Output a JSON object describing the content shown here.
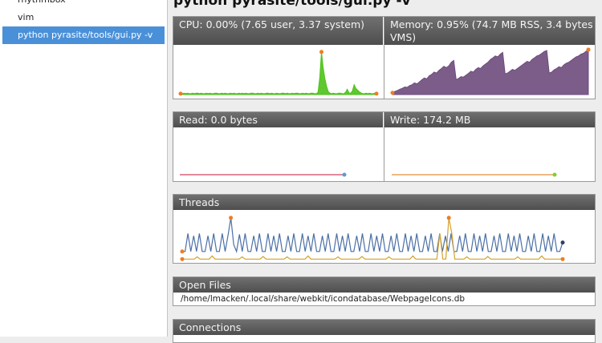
{
  "sidebar": {
    "items": [
      {
        "label": "rhythmbox"
      },
      {
        "label": "vim"
      },
      {
        "label": "python pyrasite/tools/gui.py -v"
      }
    ]
  },
  "title": "python pyrasite/tools/gui.py -v",
  "cpu": {
    "label": "CPU: 0.00% (7.65 user, 3.37 system)",
    "color": "#4ec21a",
    "values": [
      2,
      2,
      3,
      2,
      3,
      2,
      2,
      3,
      2,
      3,
      3,
      2,
      3,
      2,
      2,
      3,
      2,
      3,
      2,
      2,
      3,
      3,
      2,
      2,
      3,
      2,
      3,
      2,
      2,
      3,
      2,
      3,
      2,
      2,
      3,
      2,
      3,
      2,
      3,
      2,
      2,
      3,
      3,
      2,
      2,
      3,
      2,
      3,
      2,
      2,
      3,
      3,
      2,
      3,
      2,
      2,
      3,
      2,
      2,
      3,
      3,
      2,
      3,
      2,
      2,
      3,
      2,
      3,
      3,
      2,
      2,
      3,
      2,
      3,
      2,
      2,
      3,
      3,
      2,
      2,
      5,
      38,
      95,
      60,
      35,
      18,
      6,
      3,
      2,
      3,
      2,
      2,
      3,
      3,
      2,
      2,
      5,
      12,
      4,
      3,
      8,
      22,
      14,
      10,
      6,
      4,
      2,
      2,
      3,
      2,
      3,
      2,
      2,
      3,
      2
    ]
  },
  "memory": {
    "label": "Memory: 0.95% (74.7 MB RSS, 3.4 bytes VMS)",
    "color": "#6e4b7c",
    "values": [
      4,
      7,
      9,
      12,
      14,
      17,
      16,
      20,
      22,
      26,
      24,
      28,
      33,
      37,
      35,
      42,
      45,
      50,
      48,
      54,
      58,
      63,
      60,
      64,
      72,
      76,
      33,
      36,
      40,
      39,
      43,
      47,
      52,
      50,
      56,
      60,
      58,
      64,
      68,
      72,
      78,
      82,
      86,
      84,
      90,
      94,
      46,
      48,
      52,
      56,
      54,
      58,
      62,
      66,
      70,
      74,
      72,
      78,
      82,
      86,
      88,
      92,
      96,
      98,
      48,
      50,
      55,
      58,
      62,
      60,
      66,
      70,
      72,
      76,
      80,
      84,
      86,
      90,
      92,
      96,
      100
    ]
  },
  "read": {
    "label": "Read: 0.0 bytes",
    "color": "#d9627b",
    "end_color": "#5b9bd5"
  },
  "write": {
    "label": "Write: 174.2 MB",
    "color": "#e8a45a",
    "end_color": "#7cd12e"
  },
  "threads": {
    "label": "Threads",
    "series": [
      {
        "color": "#4a6fa5",
        "values": [
          20,
          20,
          60,
          20,
          55,
          20,
          60,
          20,
          20,
          55,
          20,
          60,
          20,
          20,
          60,
          20,
          55,
          95,
          35,
          20,
          58,
          20,
          60,
          20,
          20,
          55,
          20,
          60,
          20,
          20,
          60,
          20,
          55,
          20,
          60,
          20,
          20,
          55,
          20,
          60,
          20,
          20,
          60,
          20,
          55,
          20,
          60,
          20,
          20,
          55,
          20,
          60,
          20,
          20,
          60,
          20,
          55,
          20,
          60,
          20,
          20,
          55,
          20,
          60,
          20,
          20,
          60,
          20,
          55,
          20,
          60,
          20,
          20,
          55,
          20,
          60,
          20,
          20,
          60,
          20,
          55,
          20,
          60,
          20,
          20,
          55,
          20,
          60,
          20,
          20,
          60,
          20,
          55,
          20,
          60,
          20,
          20,
          55,
          20,
          60,
          20,
          20,
          60,
          20,
          55,
          20,
          60,
          20,
          20,
          55,
          20,
          60,
          20,
          20,
          60,
          20,
          55,
          20,
          60,
          20,
          20,
          55,
          20,
          60,
          20,
          20,
          60,
          20,
          55,
          20,
          60,
          20,
          20,
          40
        ]
      },
      {
        "color": "#d4a12a",
        "values": [
          3,
          3,
          3,
          3,
          3,
          8,
          3,
          3,
          3,
          3,
          10,
          3,
          3,
          3,
          3,
          3,
          3,
          3,
          3,
          3,
          8,
          3,
          3,
          3,
          3,
          3,
          3,
          9,
          3,
          3,
          3,
          3,
          3,
          3,
          3,
          8,
          3,
          3,
          3,
          3,
          3,
          3,
          10,
          3,
          3,
          3,
          3,
          3,
          3,
          3,
          3,
          3,
          8,
          3,
          3,
          3,
          3,
          3,
          3,
          3,
          9,
          3,
          3,
          3,
          3,
          3,
          3,
          3,
          3,
          8,
          3,
          3,
          3,
          3,
          3,
          3,
          3,
          10,
          3,
          3,
          3,
          3,
          3,
          3,
          3,
          3,
          60,
          3,
          3,
          95,
          60,
          3,
          3,
          3,
          3,
          8,
          3,
          3,
          3,
          3,
          3,
          3,
          9,
          3,
          3,
          3,
          3,
          3,
          3,
          3,
          3,
          3,
          8,
          3,
          3,
          3,
          3,
          3,
          3,
          3,
          10,
          3,
          3,
          3,
          3,
          3,
          3,
          3
        ]
      }
    ]
  },
  "open_files": {
    "label": "Open Files",
    "path": "/home/lmacken/.local/share/webkit/icondatabase/WebpageIcons.db"
  },
  "connections": {
    "label": "Connections"
  }
}
